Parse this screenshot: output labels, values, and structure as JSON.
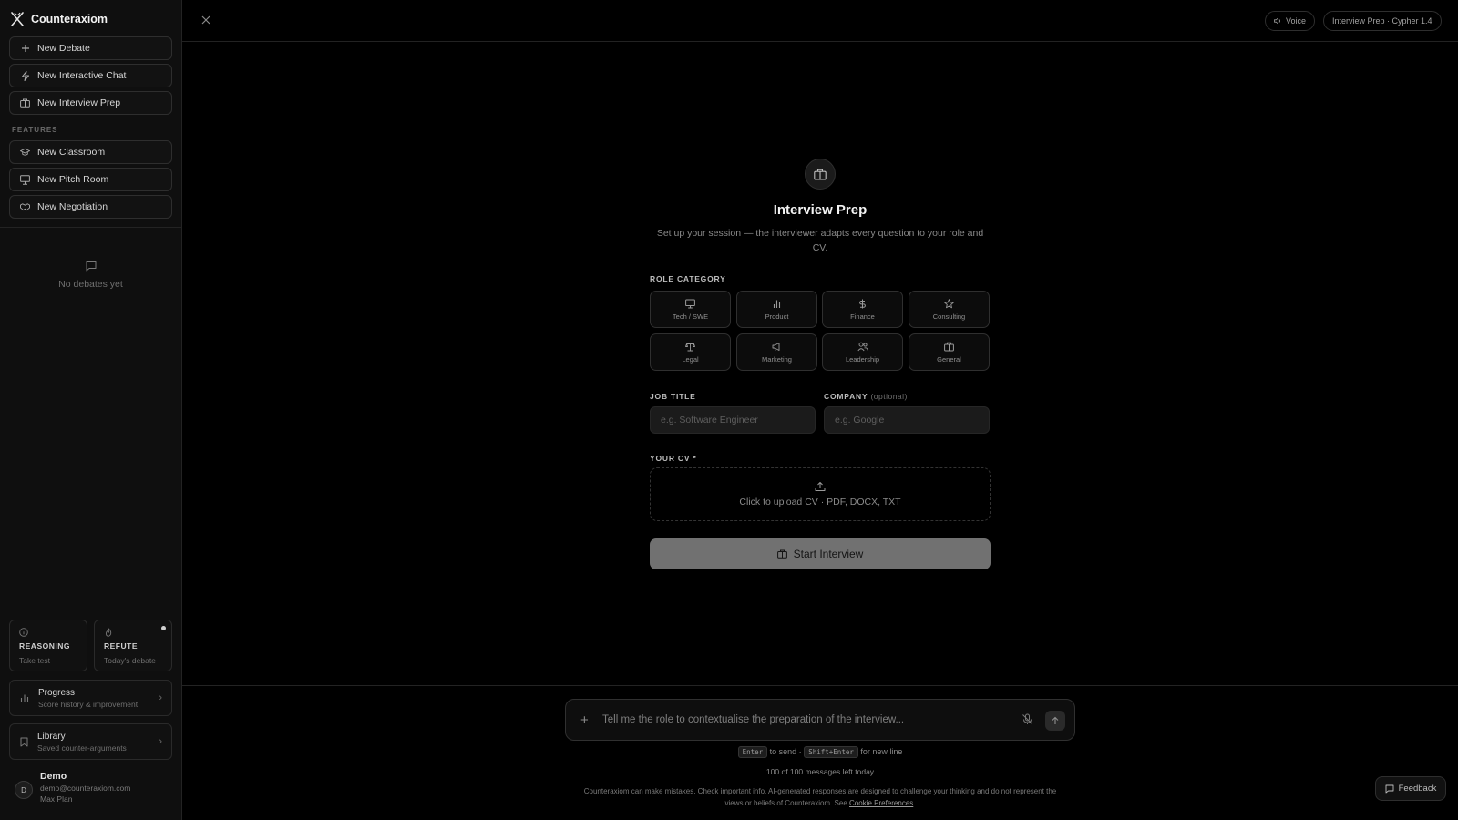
{
  "app": {
    "name": "Counteraxiom"
  },
  "sidebar": {
    "actions": [
      {
        "label": "New Debate",
        "icon": "plus-icon"
      },
      {
        "label": "New Interactive Chat",
        "icon": "bolt-icon"
      },
      {
        "label": "New Interview Prep",
        "icon": "briefcase-icon"
      }
    ],
    "features_label": "FEATURES",
    "features": [
      {
        "label": "New Classroom",
        "icon": "graduation-cap-icon"
      },
      {
        "label": "New Pitch Room",
        "icon": "presentation-icon"
      },
      {
        "label": "New Negotiation",
        "icon": "handshake-icon"
      }
    ],
    "empty_text": "No debates yet",
    "cards": {
      "reasoning": {
        "title": "REASONING",
        "sub": "Take test"
      },
      "refute": {
        "title": "REFUTE",
        "sub": "Today's debate"
      }
    },
    "progress": {
      "title": "Progress",
      "sub": "Score history & improvement"
    },
    "library": {
      "title": "Library",
      "sub": "Saved counter-arguments"
    },
    "user": {
      "initial": "D",
      "name": "Demo",
      "email": "demo@counteraxiom.com",
      "plan": "Max Plan"
    }
  },
  "topbar": {
    "voice_label": "Voice",
    "mode_label": "Interview Prep · Cypher 1.4"
  },
  "main": {
    "title": "Interview Prep",
    "subtitle": "Set up your session — the interviewer adapts every question to your role and CV.",
    "role_category_label": "ROLE CATEGORY",
    "roles": [
      {
        "label": "Tech / SWE",
        "icon": "monitor-icon"
      },
      {
        "label": "Product",
        "icon": "bar-chart-icon"
      },
      {
        "label": "Finance",
        "icon": "dollar-icon"
      },
      {
        "label": "Consulting",
        "icon": "star-icon"
      },
      {
        "label": "Legal",
        "icon": "scale-icon"
      },
      {
        "label": "Marketing",
        "icon": "megaphone-icon"
      },
      {
        "label": "Leadership",
        "icon": "users-icon"
      },
      {
        "label": "General",
        "icon": "briefcase-icon"
      }
    ],
    "job_title_label": "JOB TITLE",
    "job_title_placeholder": "e.g. Software Engineer",
    "company_label": "COMPANY",
    "company_optional": "(optional)",
    "company_placeholder": "e.g. Google",
    "cv_label": "YOUR CV *",
    "upload_text": "Click to upload CV · PDF, DOCX, TXT",
    "start_label": "Start Interview"
  },
  "composer": {
    "placeholder": "Tell me the role to contextualise the preparation of the interview...",
    "hint_enter": "Enter",
    "hint_send": "to send ·",
    "hint_shift": "Shift+Enter",
    "hint_newline": "for new line",
    "messages_left": "100 of 100 messages left today",
    "disclaimer": "Counteraxiom can make mistakes. Check important info. AI-generated responses are designed to challenge your thinking and do not represent the views or beliefs of Counteraxiom. See",
    "cookie_link": "Cookie Preferences",
    "disclaimer_end": "."
  },
  "feedback_label": "Feedback",
  "colors": {
    "background": "#000000",
    "sidebar": "#0f0f0f",
    "button_disabled": "#717171"
  }
}
